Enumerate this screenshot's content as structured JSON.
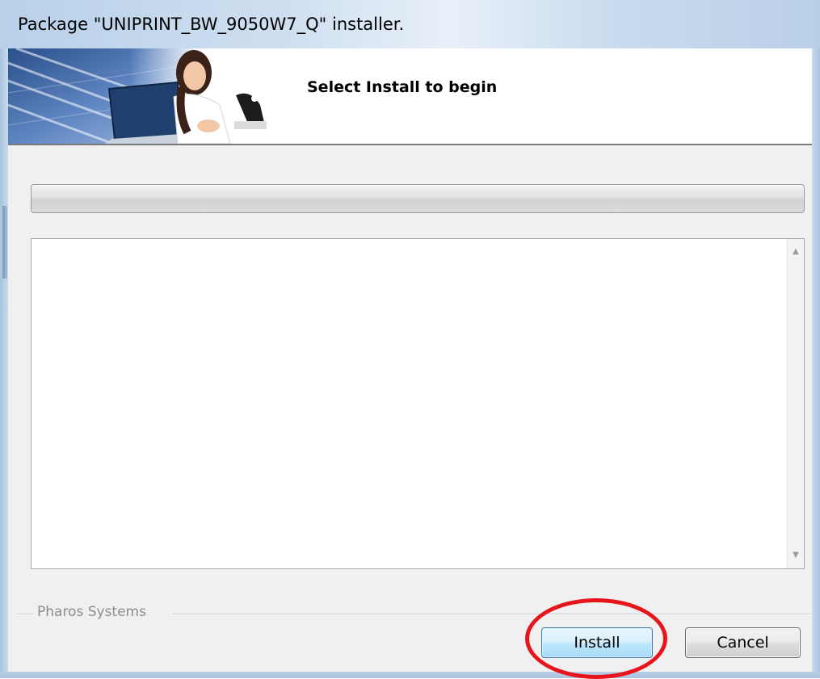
{
  "window": {
    "title": "Package \"UNIPRINT_BW_9050W7_Q\" installer."
  },
  "banner": {
    "heading": "Select Install to begin",
    "image": "person-at-laptop-banner"
  },
  "progress": {
    "value": 0
  },
  "log": {
    "text": ""
  },
  "groupbox": {
    "label": "Pharos Systems"
  },
  "buttons": {
    "install_label": "Install",
    "cancel_label": "Cancel"
  },
  "annotation": {
    "color": "#e8141c",
    "target": "install-button"
  },
  "icons": {
    "scroll_up": "scroll-up-arrow-icon",
    "scroll_down": "scroll-down-arrow-icon"
  }
}
